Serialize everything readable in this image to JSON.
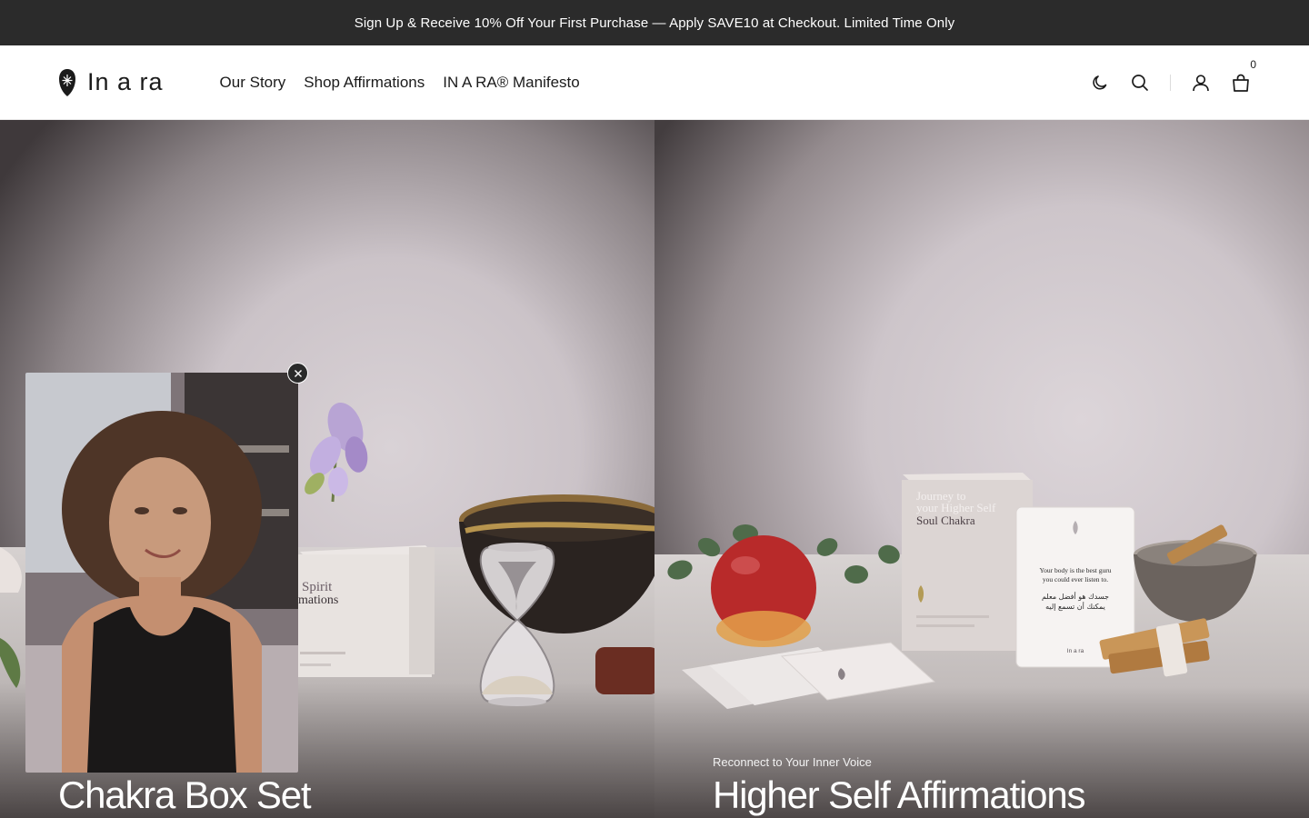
{
  "announcement": {
    "text": "Sign Up & Receive 10% Off Your First Purchase — Apply SAVE10 at Checkout. Limited Time Only"
  },
  "header": {
    "logo_text": "In a ra",
    "nav": [
      {
        "label": "Our Story"
      },
      {
        "label": "Shop Affirmations"
      },
      {
        "label": "IN A RA® Manifesto"
      }
    ],
    "cart_count": "0",
    "icons": [
      "moon-icon",
      "search-icon",
      "account-icon",
      "cart-icon"
    ]
  },
  "hero": {
    "left": {
      "eyebrow": "",
      "title": "Chakra Box Set",
      "box_text_1": "Spirit",
      "box_text_2": "mations"
    },
    "right": {
      "eyebrow": "Reconnect to Your Inner Voice",
      "title": "Higher Self Affirmations",
      "box_text_1": "Journey to",
      "box_text_2": "your Higher Self",
      "box_text_3": "Soul Chakra",
      "card_text_1": "Your body is the best guru",
      "card_text_2": "you could ever listen to.",
      "card_text_3": "جسدك هو أفضل معلم",
      "card_text_4": "يمكنك أن تسمع إليه",
      "card_brand": "In a ra"
    }
  },
  "video": {
    "close_icon": "close-icon"
  },
  "colors": {
    "announcement_bg": "#2b2b2b",
    "text": "#1b1b1b"
  }
}
